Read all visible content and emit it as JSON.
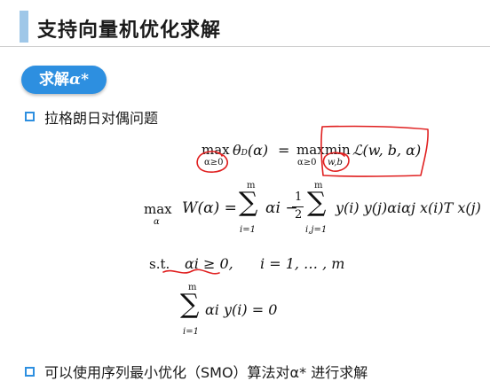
{
  "title": "支持向量机优化求解",
  "pill_label": "求解",
  "pill_symbol": "α*",
  "bullets": [
    {
      "text": "拉格朗日对偶问题"
    },
    {
      "text": "可以使用序列最小优化（SMO）算法对α* 进行求解"
    }
  ],
  "equations": {
    "eq1": {
      "lhs_op": "max",
      "lhs_sub": "α≥0",
      "lhs_fn": "θ",
      "lhs_fn_sub": "D",
      "lhs_arg": "(α)",
      "eq": "=",
      "max_op": "max",
      "max_sub": "α≥0",
      "min_op": "min",
      "min_sub": "w,b",
      "rhs": "ℒ(w, b, α)"
    },
    "eq2": {
      "op": "max",
      "op_sub": "α",
      "lhs": "W(α) =",
      "sum1_top": "m",
      "sum1_bot": "i=1",
      "term1": "αi −",
      "frac_num": "1",
      "frac_den": "2",
      "sum2_top": "m",
      "sum2_bot": "i,j=1",
      "term2": "y(i) y(j)αiαj x(i)T x(j)"
    },
    "eq3": {
      "st": "s.t.",
      "constraint": "αi ≥ 0,",
      "range": "i = 1, … , m"
    },
    "eq4": {
      "sum_top": "m",
      "sum_bot": "i=1",
      "expr": "αi y(i) = 0"
    }
  },
  "ink_color": "#e02020",
  "accent_color": "#2d8fe0"
}
